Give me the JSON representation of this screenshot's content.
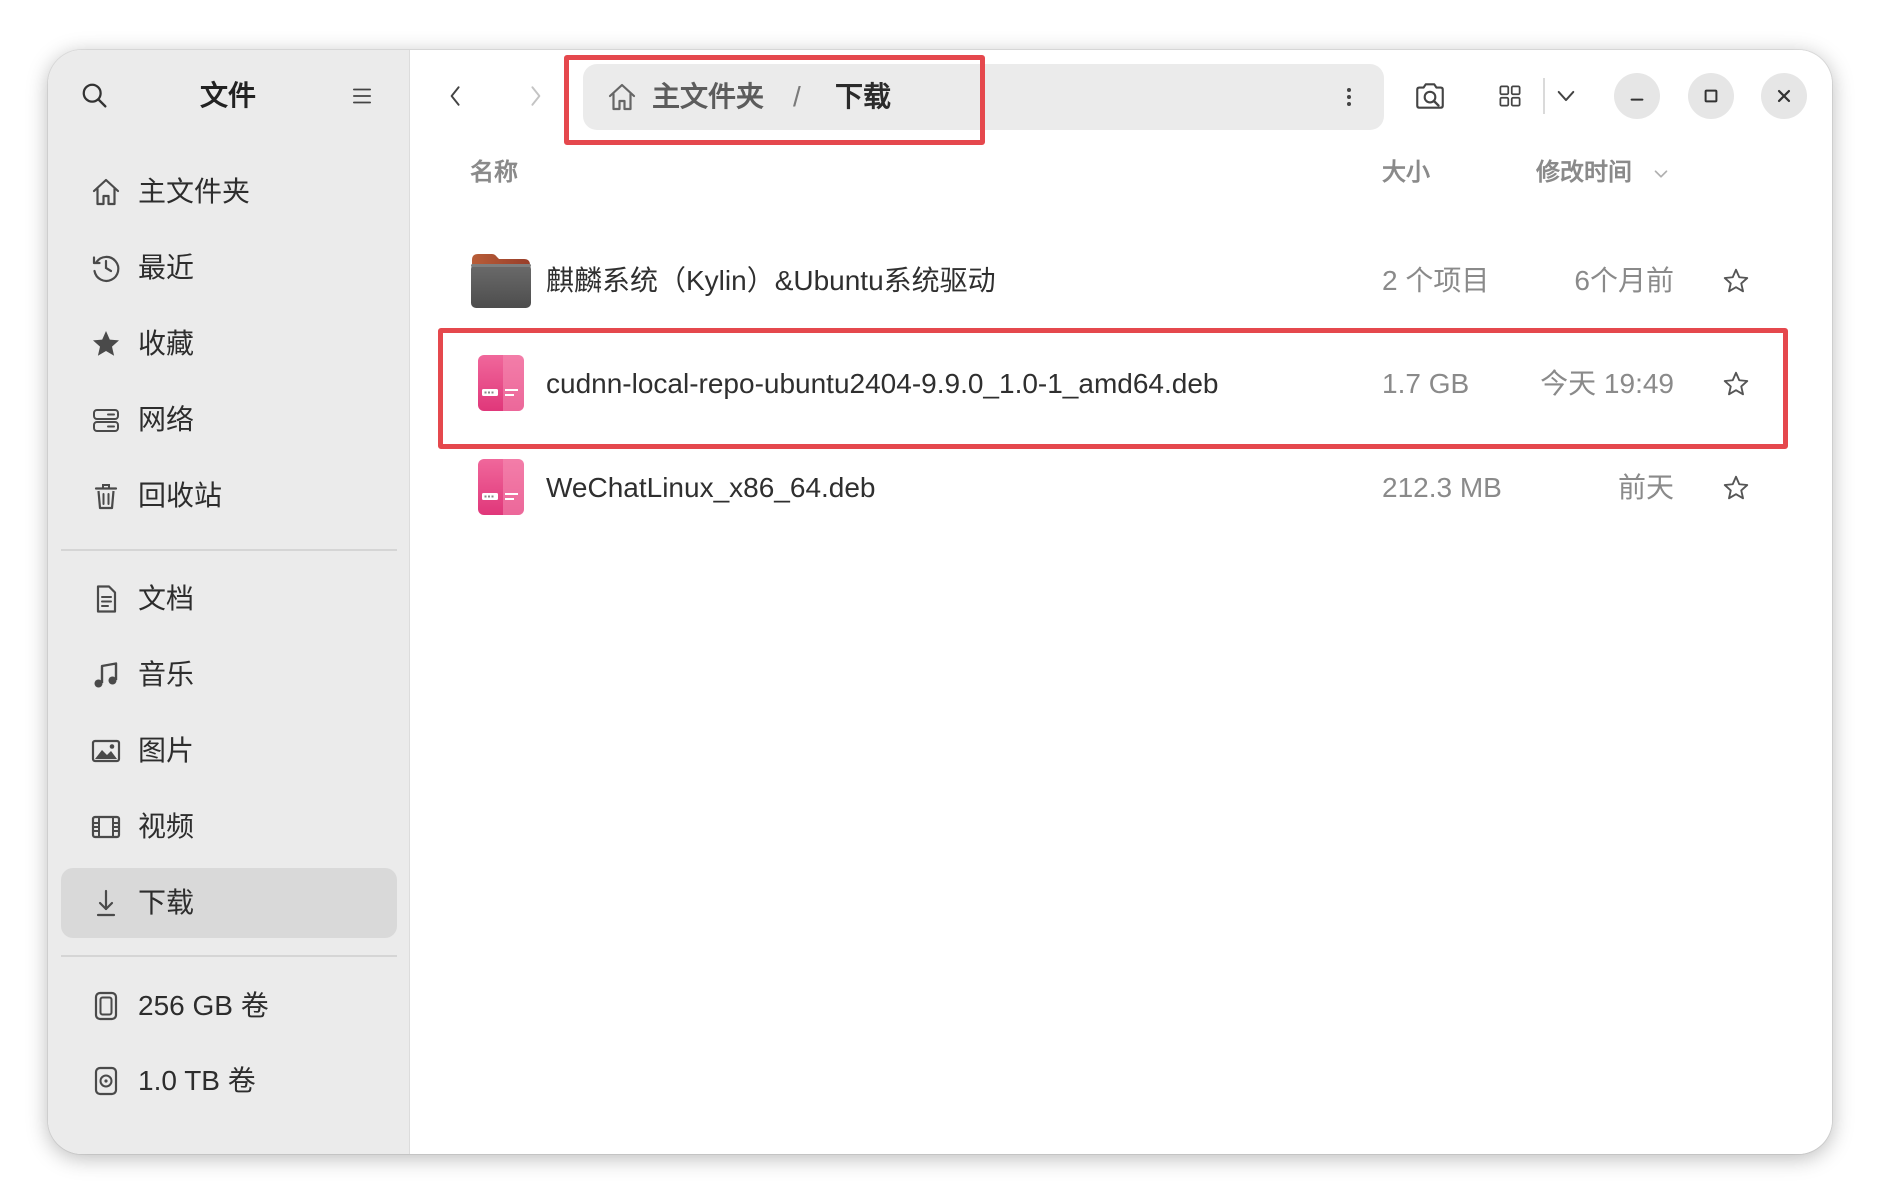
{
  "app": {
    "title": "文件"
  },
  "sidebar": {
    "places": [
      {
        "label": "主文件夹",
        "icon": "home-icon"
      },
      {
        "label": "最近",
        "icon": "recent-clock-icon"
      },
      {
        "label": "收藏",
        "icon": "starred-icon"
      },
      {
        "label": "网络",
        "icon": "network-icon"
      },
      {
        "label": "回收站",
        "icon": "trash-icon"
      }
    ],
    "bookmarks": [
      {
        "label": "文档",
        "icon": "document-icon"
      },
      {
        "label": "音乐",
        "icon": "music-icon"
      },
      {
        "label": "图片",
        "icon": "picture-icon"
      },
      {
        "label": "视频",
        "icon": "video-icon"
      },
      {
        "label": "下载",
        "icon": "download-icon",
        "selected": true
      }
    ],
    "devices": [
      {
        "label": "256 GB 卷",
        "icon": "drive-icon"
      },
      {
        "label": "1.0 TB 卷",
        "icon": "disc-drive-icon"
      }
    ]
  },
  "pathbar": {
    "segments": [
      "主文件夹",
      "下载"
    ],
    "separator": "/",
    "highlighted": true
  },
  "columns": {
    "name": "名称",
    "size": "大小",
    "modified": "修改时间"
  },
  "files": [
    {
      "name": "麒麟系统（Kylin）&Ubuntu系统驱动",
      "size": "2 个项目",
      "modified": "6个月前",
      "icon": "folder-icon",
      "starred": false,
      "highlighted": false
    },
    {
      "name": "cudnn-local-repo-ubuntu2404-9.9.0_1.0-1_amd64.deb",
      "size": "1.7 GB",
      "modified": "今天 19:49",
      "icon": "deb-package-icon",
      "starred": false,
      "highlighted": true
    },
    {
      "name": "WeChatLinux_x86_64.deb",
      "size": "212.3 MB",
      "modified": "前天",
      "icon": "deb-package-icon",
      "starred": false,
      "highlighted": false
    }
  ],
  "colors": {
    "highlight": "#e5484d",
    "sidebar_bg": "#ebebeb",
    "selected_bg": "#d9d9d9"
  }
}
